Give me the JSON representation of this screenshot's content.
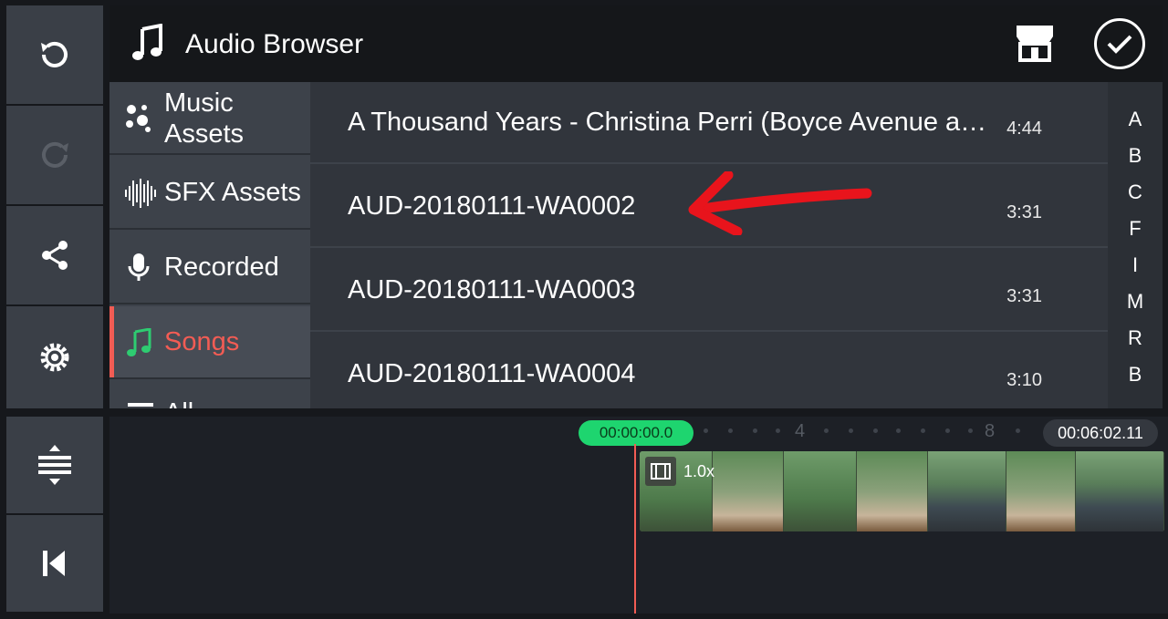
{
  "header": {
    "title": "Audio Browser"
  },
  "sidebar": {
    "items": [
      {
        "label": "Music\nAssets"
      },
      {
        "label": "SFX Assets"
      },
      {
        "label": "Recorded"
      },
      {
        "label": "Songs",
        "active": true
      },
      {
        "label": "All"
      }
    ]
  },
  "songs": [
    {
      "name": "A Thousand Years - Christina Perri (Boyce Avenue a…",
      "duration": "4:44"
    },
    {
      "name": "AUD-20180111-WA0002",
      "duration": "3:31"
    },
    {
      "name": "AUD-20180111-WA0003",
      "duration": "3:31"
    },
    {
      "name": "AUD-20180111-WA0004",
      "duration": "3:10"
    }
  ],
  "index_letters": [
    "A",
    "B",
    "C",
    "F",
    "I",
    "M",
    "R",
    "B"
  ],
  "timeline": {
    "current_time": "00:00:00.0",
    "total_time": "00:06:02.11",
    "ruler_marks": [
      "4",
      "8"
    ],
    "clip_speed": "1.0x"
  },
  "colors": {
    "accent": "#f25c54",
    "playhead_pill": "#1ed56f",
    "songs_icon": "#2ecc71"
  }
}
